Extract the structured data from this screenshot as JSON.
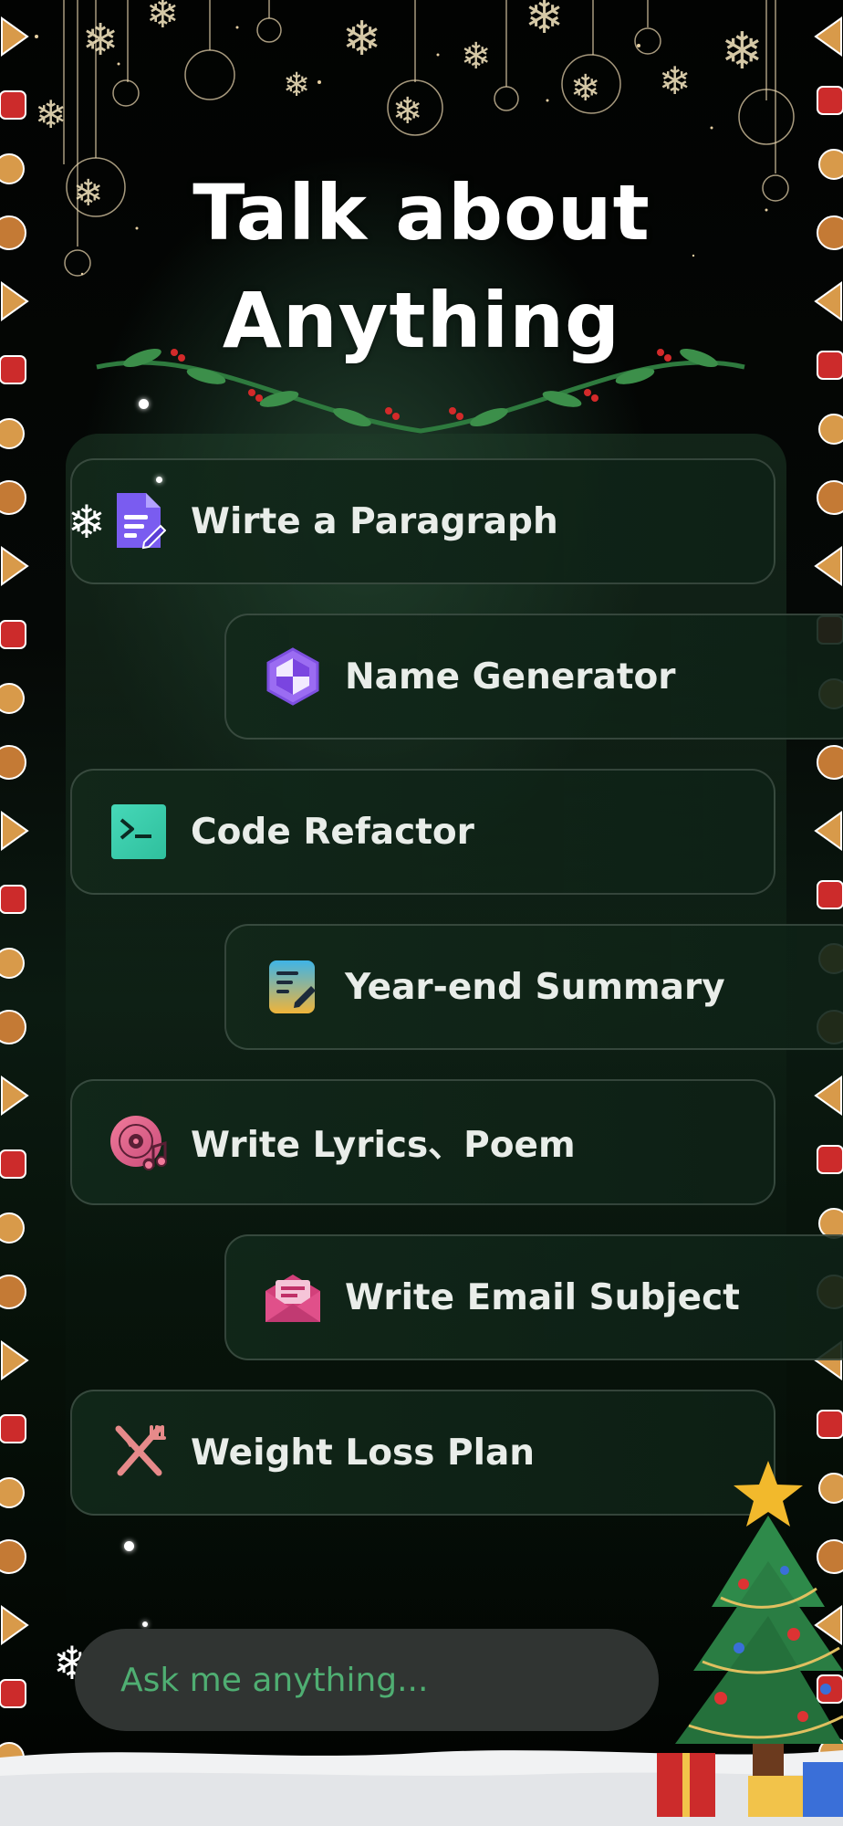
{
  "header": {
    "title_line1": "Talk about",
    "title_line2": "Anything"
  },
  "prompts": [
    {
      "label": "Wirte a Paragraph",
      "icon": "document-edit-icon"
    },
    {
      "label": "Name Generator",
      "icon": "hexagon-icon"
    },
    {
      "label": "Code Refactor",
      "icon": "terminal-icon"
    },
    {
      "label": "Year-end Summary",
      "icon": "notepad-icon"
    },
    {
      "label": "Write Lyrics、Poem",
      "icon": "music-disc-icon"
    },
    {
      "label": "Write Email Subject",
      "icon": "envelope-icon"
    },
    {
      "label": "Weight Loss Plan",
      "icon": "fork-knife-icon"
    }
  ],
  "input": {
    "placeholder": "Ask me anything..."
  },
  "colors": {
    "background": "#000000",
    "card_bg": "#12281a",
    "accent_green": "#4fae72",
    "title": "#ffffff"
  }
}
